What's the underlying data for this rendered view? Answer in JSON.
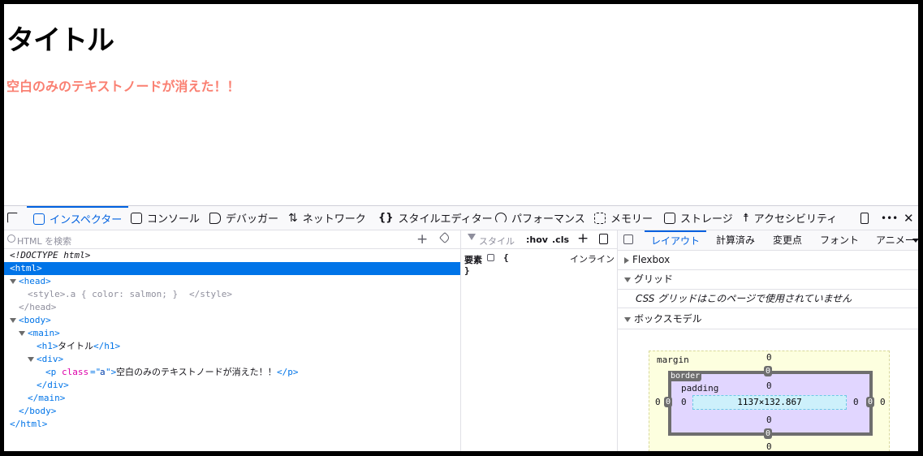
{
  "page": {
    "heading": "タイトル",
    "paragraph": "空白のみのテキストノードが消えた！！"
  },
  "toolbar": {
    "tabs": [
      "インスペクター",
      "コンソール",
      "デバッガー",
      "ネットワーク",
      "スタイルエディター",
      "パフォーマンス",
      "メモリー",
      "ストレージ",
      "アクセシビリティ"
    ],
    "more": "•••",
    "close": "✕"
  },
  "markup": {
    "search_placeholder": "HTML を検索",
    "add": "+",
    "lines": [
      "<!DOCTYPE html>",
      "<html>",
      "<head>",
      "<style>",
      ".a { color: salmon; }",
      "</style>",
      "</head>",
      "<body>",
      "<main>",
      "<h1>",
      "タイトル",
      "</h1>",
      "<div>",
      "<p",
      "class",
      "=\"",
      "a",
      "\">",
      "空白のみのテキストノードが消えた！！",
      "</p>",
      "</div>",
      "</main>",
      "</body>",
      "</html>"
    ]
  },
  "rules": {
    "filter_placeholder": "スタイル",
    "hov": ":hov",
    "cls": ".cls",
    "add": "+",
    "element_label": "要素",
    "open_brace": "{",
    "close_brace": "}",
    "inline": "インライン"
  },
  "layout_panel": {
    "tabs": [
      "レイアウト",
      "計算済み",
      "変更点",
      "フォント",
      "アニメー"
    ],
    "flexbox": "Flexbox",
    "grid": "グリッド",
    "grid_message": "CSS グリッドはこのページで使用されていません",
    "boxmodel": "ボックスモデル",
    "margin_label": "margin",
    "border_label": "border",
    "padding_label": "padding",
    "content_size": "1137×132.867",
    "zero": "0"
  }
}
